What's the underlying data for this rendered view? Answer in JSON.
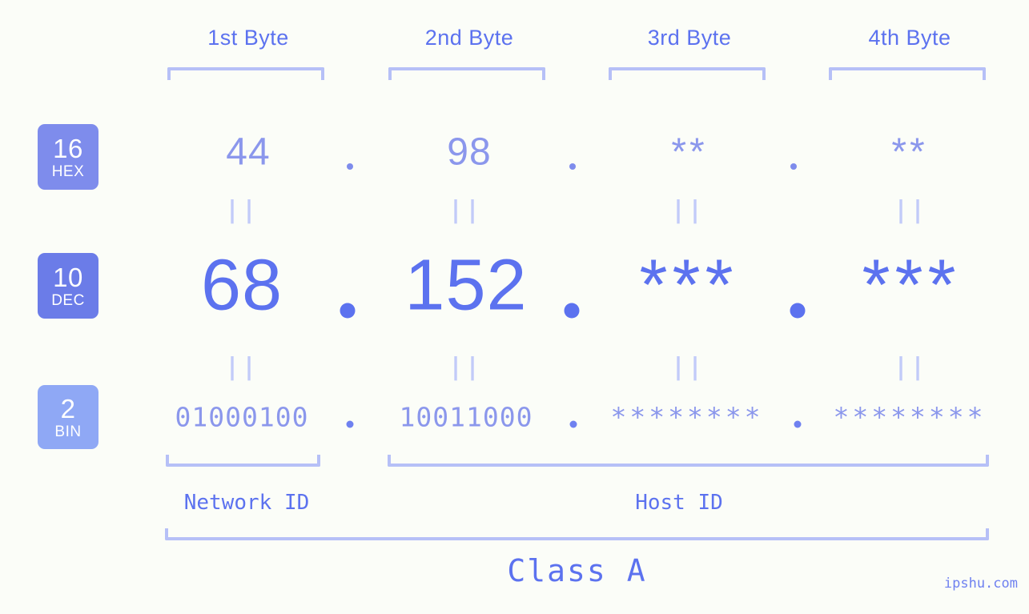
{
  "background_color": "#fbfdf8",
  "accent_colors": {
    "primary_blue": "#5c72ef",
    "light_blue": "#8b97ec",
    "bracket_blue": "#b6c0f7",
    "badge_hex": "#7e8cec",
    "badge_dec": "#6b7ce8",
    "badge_bin": "#8fa8f5",
    "equals_mark": "#c2cbf9"
  },
  "byte_headers": [
    {
      "label": "1st Byte"
    },
    {
      "label": "2nd Byte"
    },
    {
      "label": "3rd Byte"
    },
    {
      "label": "4th Byte"
    }
  ],
  "bases": [
    {
      "id": "hex",
      "number": "16",
      "abbr": "HEX"
    },
    {
      "id": "dec",
      "number": "10",
      "abbr": "DEC"
    },
    {
      "id": "bin",
      "number": "2",
      "abbr": "BIN"
    }
  ],
  "rows": {
    "hex": {
      "values": [
        "44",
        "98",
        "**",
        "**"
      ],
      "separator": "."
    },
    "dec": {
      "values": [
        "68",
        "152",
        "***",
        "***"
      ],
      "separator": "."
    },
    "bin": {
      "values": [
        "01000100",
        "10011000",
        "********",
        "********"
      ],
      "separator": "."
    }
  },
  "equality_marks": {
    "glyph": "||",
    "count_per_row": 4,
    "rows": 2
  },
  "segments": {
    "network_id": {
      "label": "Network ID"
    },
    "host_id": {
      "label": "Host ID"
    }
  },
  "class": {
    "label": "Class A"
  },
  "watermark": {
    "text": "ipshu.com"
  }
}
